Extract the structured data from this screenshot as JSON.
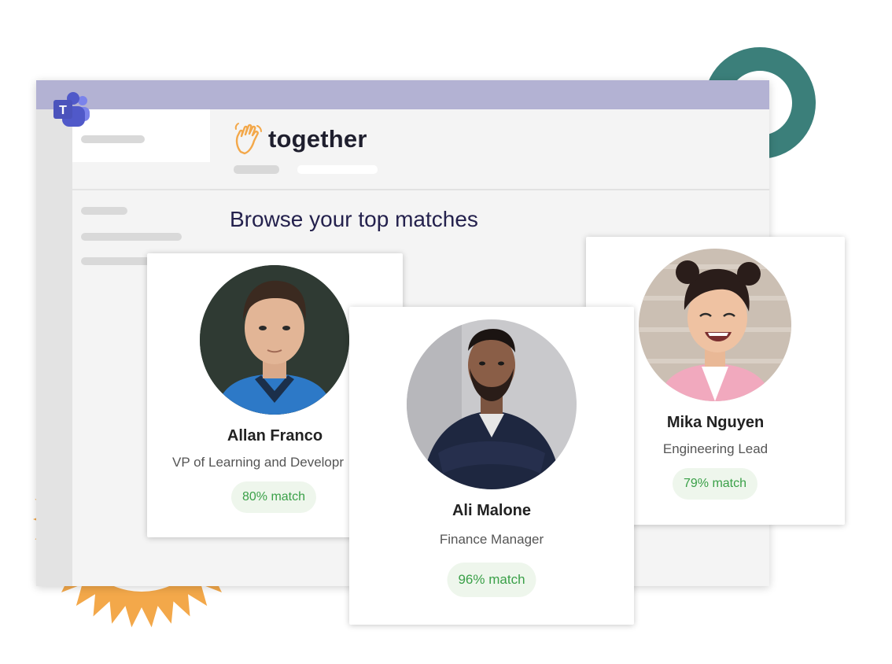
{
  "colors": {
    "titlebar": "#b3b2d3",
    "accent_ring": "#3b7f7a",
    "accent_burst": "#f3a84a",
    "logo_orange": "#f3a84a",
    "title_navy": "#24214d",
    "match_text": "#3aa048",
    "match_bg": "#eef6ec"
  },
  "app": {
    "icon": "teams-icon",
    "brand": {
      "icon": "waving-hand-icon",
      "name": "together"
    },
    "page_title": "Browse your top matches"
  },
  "profiles": [
    {
      "name": "Allan Franco",
      "role": "VP of Learning and Developr",
      "match": "80% match",
      "avatar": "person-blue-jacket-avatar"
    },
    {
      "name": "Ali Malone",
      "role": "Finance Manager",
      "match": "96% match",
      "avatar": "person-navy-sweater-avatar"
    },
    {
      "name": "Mika Nguyen",
      "role": "Engineering Lead",
      "match": "79% match",
      "avatar": "person-pink-blazer-avatar"
    }
  ]
}
